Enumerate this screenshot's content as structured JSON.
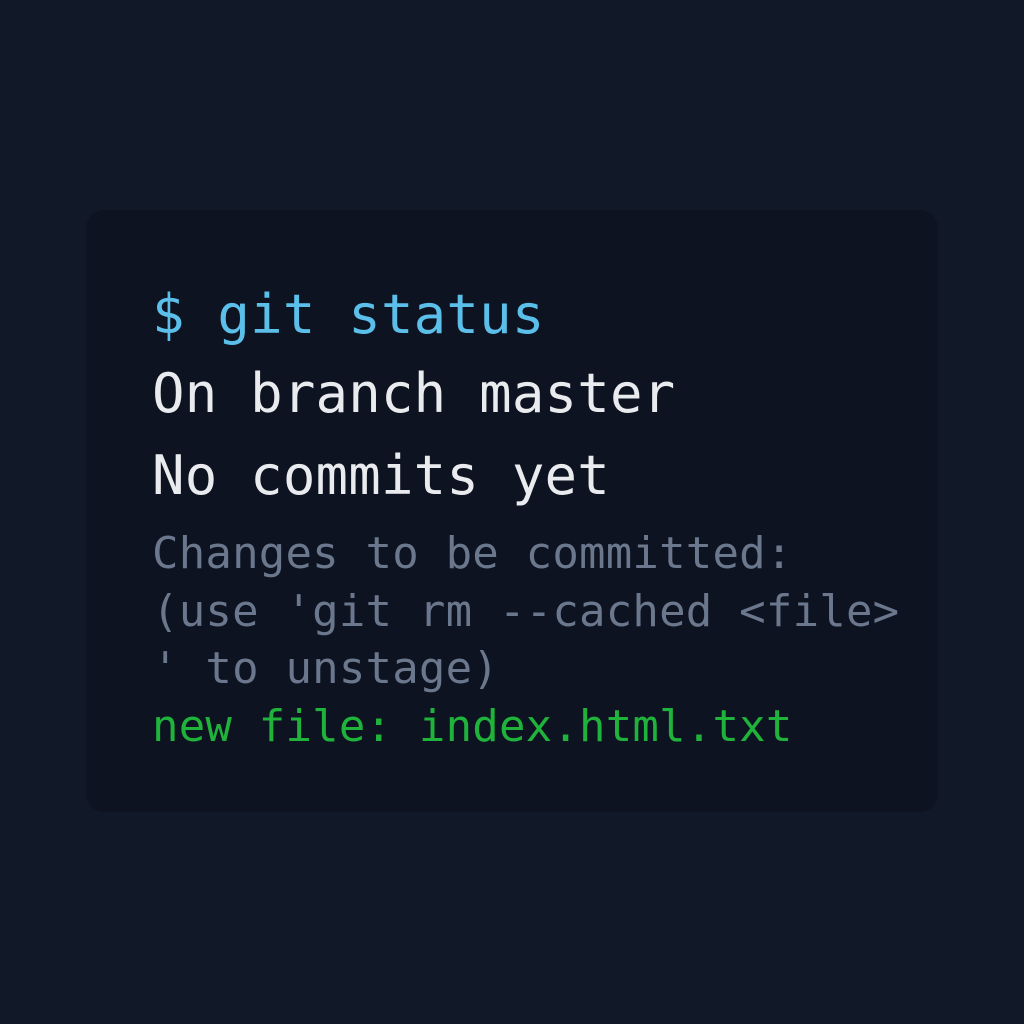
{
  "terminal": {
    "prompt_command": "$ git status",
    "output": {
      "branch_line": "On branch master",
      "commits_line": "No commits yet",
      "changes_header": "Changes to be committed:",
      "hint_line_1": "(use 'git rm --cached <file>",
      "hint_line_2": "' to unstage)",
      "staged_file_line": "new file: index.html.txt"
    }
  },
  "colors": {
    "page_background": "#111827",
    "terminal_background": "#0d1320",
    "command": "#5bbfe9",
    "primary_text": "#e9ebee",
    "hint_text": "#6b778d",
    "staged_file": "#1fb33c"
  }
}
